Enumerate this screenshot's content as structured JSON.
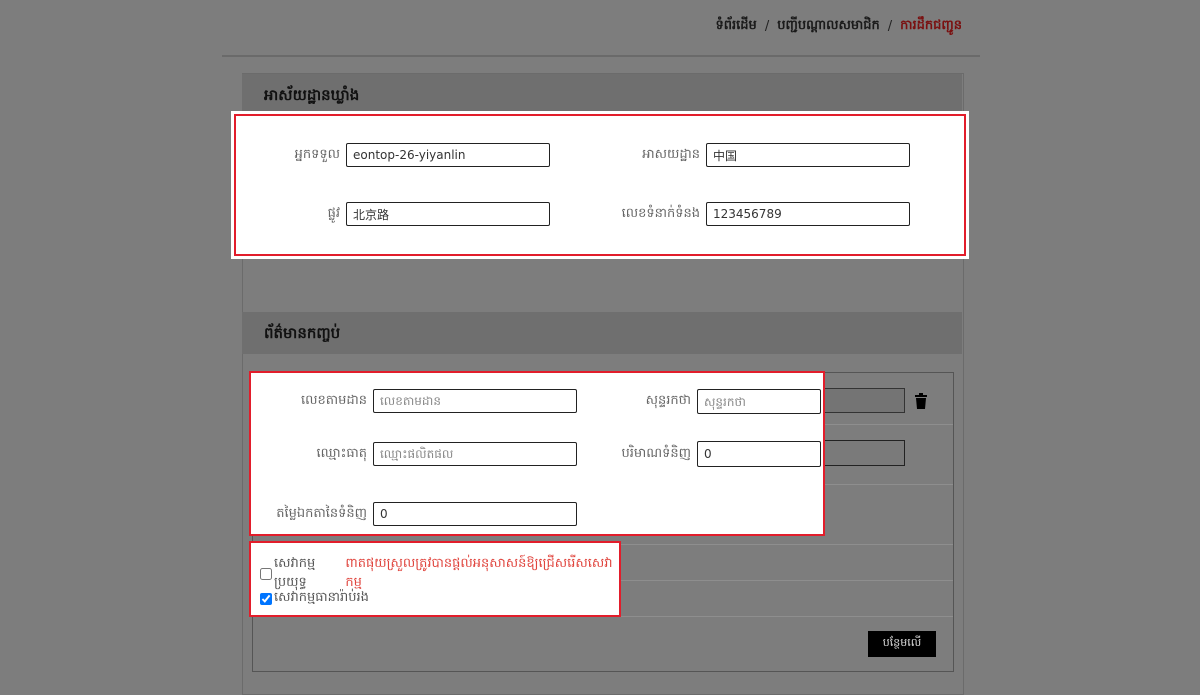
{
  "breadcrumb": {
    "home": "ទំព័រដើម",
    "members": "បញ្ជីបណ្ដាលសមាជិក",
    "current": "ការដឹកជញ្ជូន",
    "separator": "/"
  },
  "warehouse": {
    "title": "អាស័យដ្ឋានឃ្លាំង",
    "recipient_label": "អ្នកទទួល",
    "recipient_value": "eontop-26-yiyanlin",
    "address_label": "អាសយដ្ឋាន",
    "address_value": "中国",
    "street_label": "ផ្លូវ",
    "street_value": "北京路",
    "phone_label": "លេខទំនាក់ទំនង",
    "phone_value": "123456789"
  },
  "package": {
    "title": "ព័ត៌មានកញ្ចប់",
    "tracking_label": "លេខតាមដាន",
    "tracking_placeholder": "លេខតាមដាន",
    "note_label": "សុន្ទរកថា",
    "note_placeholder": "សុន្ទរកថា",
    "goods_label": "ឈ្មោះធាតុ",
    "goods_placeholder": "ឈ្មោះផលិតផល",
    "quantity_label": "បរិមាណទំនិញ",
    "quantity_value": "0",
    "unit_price_label": "តម្លៃឯកតានៃទំនិញ",
    "unit_price_value": "0",
    "insurance_label": "សេវាកម្មប្រយុទ្ធ",
    "insurance_warning": "ពាតផុយស្រួលត្រូវបានផ្ដល់អនុសាសន៍ឱ្យជ្រើសរើសសេវាកម្ម",
    "insurance_checked": false,
    "packaging_label": "សេវាកម្មធានារ៉ាប់រង",
    "packaging_checked": true,
    "add_button": "បន្ថែមលើ"
  },
  "colors": {
    "highlight": "#e21d2b",
    "warning_text": "#e0453e"
  }
}
